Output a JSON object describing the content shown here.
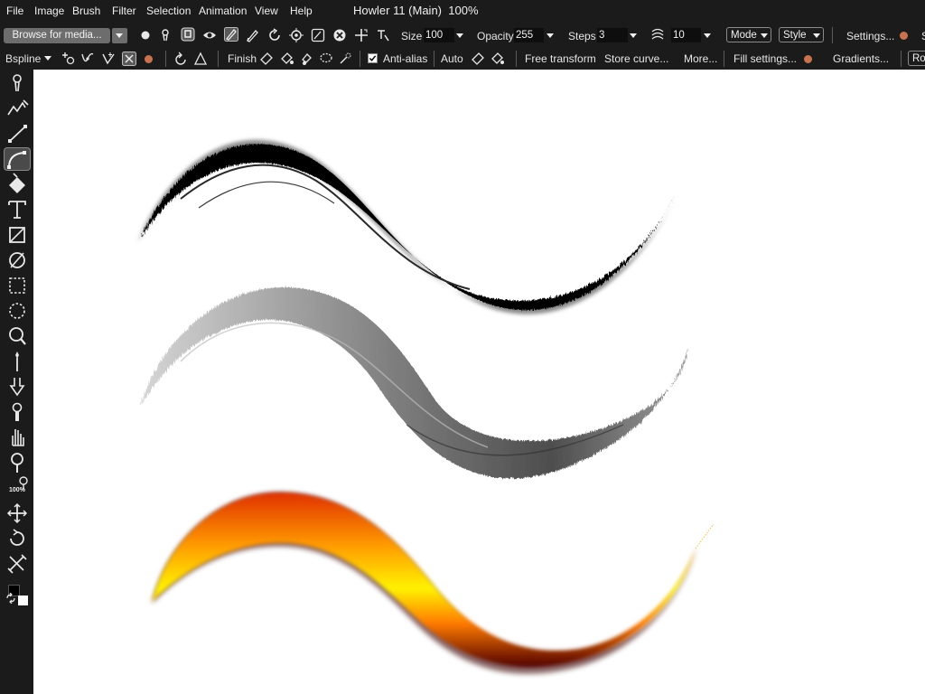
{
  "menu": [
    "File",
    "Image",
    "Brush",
    "Filter",
    "Selection",
    "Animation",
    "View",
    "Help"
  ],
  "window_title": "Howler 11 (Main)",
  "zoom": "100%",
  "toolbar1": {
    "browse_label": "Browse for media...",
    "size_label": "Size",
    "size_value": "100",
    "opacity_label": "Opacity",
    "opacity_value": "255",
    "steps_label": "Steps",
    "steps_value": "3",
    "spacing_value": "10",
    "mode_label": "Mode",
    "style_label": "Style",
    "settings_label": "Settings..."
  },
  "toolbar2": {
    "curve_type": "Bspline",
    "finish_label": "Finish",
    "antialias_label": "Anti-alias",
    "antialias_checked": true,
    "auto_label": "Auto",
    "free_transform_label": "Free transform",
    "store_curve_label": "Store curve...",
    "more_label": "More...",
    "fill_settings_label": "Fill settings...",
    "gradients_label": "Gradients...",
    "rot_label": "Rot"
  },
  "sidebar": {
    "zoom_label": "100%",
    "tools": [
      "brush-tool",
      "stroke-tool",
      "line-tool",
      "curve-tool",
      "fill-tool",
      "text-tool",
      "rectangle-shape-tool",
      "ellipse-shape-tool",
      "rect-select-tool",
      "ellipse-select-tool",
      "lasso-tool",
      "magic-wand-tool",
      "smudge-tool",
      "clone-tool",
      "pan-tool",
      "eyedropper-tool",
      "zoom-tool",
      "move-tool",
      "rotate-tool",
      "transform-tool"
    ],
    "selected_tool": "curve-tool",
    "primary_color": "#000000",
    "secondary_color": "#ffffff"
  },
  "colors": {
    "stroke1": "#000000",
    "stroke2_gradient": [
      "#d4d4d4",
      "#7a7a7a",
      "#444444",
      "#9a9a9a"
    ],
    "stroke3_gradient": [
      "#fff200",
      "#ff9a00",
      "#e03000",
      "#500000"
    ]
  }
}
